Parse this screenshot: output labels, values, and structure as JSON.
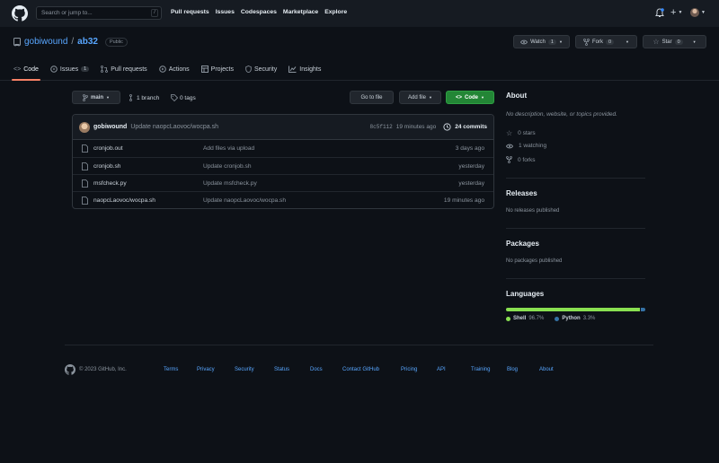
{
  "header": {
    "search_placeholder": "Search or jump to...",
    "slash_key": "/",
    "nav": [
      "Pull requests",
      "Issues",
      "Codespaces",
      "Marketplace",
      "Explore"
    ],
    "plus_label": "+"
  },
  "repo": {
    "owner": "gobiwound",
    "separator": "/",
    "name": "ab32",
    "visibility": "Public",
    "watch_label": "Watch",
    "watch_count": "1",
    "fork_label": "Fork",
    "fork_count": "0",
    "star_label": "Star",
    "star_count": "0"
  },
  "tabs": {
    "code": "Code",
    "issues": "Issues",
    "issues_count": "1",
    "pulls": "Pull requests",
    "actions": "Actions",
    "projects": "Projects",
    "security": "Security",
    "insights": "Insights"
  },
  "toolbar": {
    "branch": "main",
    "branches": "1 branch",
    "tags": "0 tags",
    "goto": "Go to file",
    "addfile": "Add file",
    "code": "Code"
  },
  "commit": {
    "author": "gobiwound",
    "message": "Update naopcLaovoc/wocpa.sh",
    "sha": "8c5f112",
    "age": "19 minutes ago",
    "count": "24 commits"
  },
  "files": [
    {
      "name": "cronjob.out",
      "message": "Add files via upload",
      "age": "3 days ago"
    },
    {
      "name": "cronjob.sh",
      "message": "Update cronjob.sh",
      "age": "yesterday"
    },
    {
      "name": "msfcheck.py",
      "message": "Update msfcheck.py",
      "age": "yesterday"
    },
    {
      "name": "naopcLaovoc/wocpa.sh",
      "message": "Update naopcLaovoc/wocpa.sh",
      "age": "19 minutes ago"
    }
  ],
  "about": {
    "title": "About",
    "description": "No description, website, or topics provided.",
    "stars": "0 stars",
    "watching": "1 watching",
    "forks": "0 forks"
  },
  "releases": {
    "title": "Releases",
    "text": "No releases published"
  },
  "packages": {
    "title": "Packages",
    "text": "No packages published"
  },
  "languages": {
    "title": "Languages",
    "items": [
      {
        "name": "Shell",
        "percent": "96.7%",
        "color": "#89e051",
        "fraction": 0.967
      },
      {
        "name": "Python",
        "percent": "3.3%",
        "color": "#3572A5",
        "fraction": 0.033
      }
    ]
  },
  "footer": {
    "copyright": "© 2023 GitHub, Inc.",
    "links": [
      "Terms",
      "Privacy",
      "Security",
      "Status",
      "Docs",
      "Contact GitHub",
      "Pricing",
      "API",
      "Training",
      "Blog",
      "About"
    ]
  },
  "colors": {
    "accent": "#58a6ff",
    "green": "#238636",
    "tab_underline": "#f78166"
  }
}
